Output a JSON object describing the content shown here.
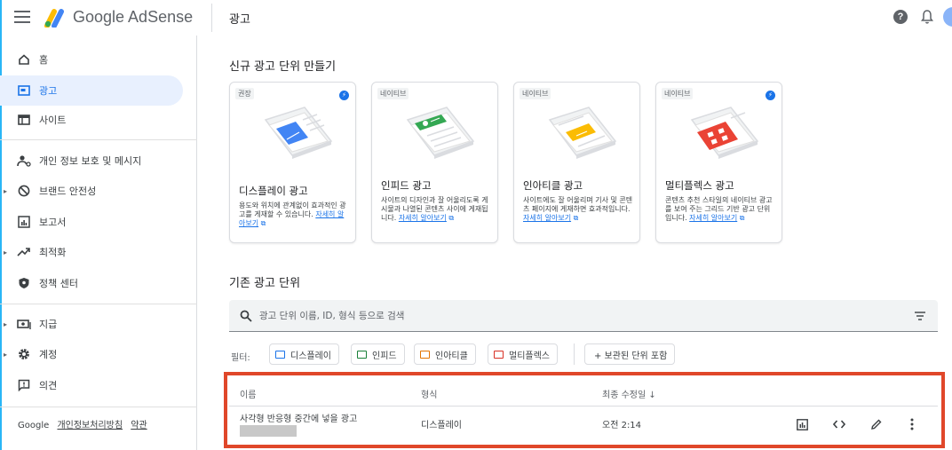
{
  "app": {
    "brand": "Google AdSense",
    "page_title": "광고",
    "help_glyph": "?"
  },
  "sidebar": {
    "items": [
      {
        "label": "홈",
        "icon": "home-icon"
      },
      {
        "label": "광고",
        "icon": "ads-icon",
        "active": true
      },
      {
        "label": "사이트",
        "icon": "sites-icon"
      },
      {
        "label": "개인 정보 보호 및 메시지",
        "icon": "privacy-person-icon"
      },
      {
        "label": "브랜드 안전성",
        "icon": "block-icon",
        "expandable": true
      },
      {
        "label": "보고서",
        "icon": "reports-icon"
      },
      {
        "label": "최적화",
        "icon": "trending-icon",
        "expandable": true
      },
      {
        "label": "정책 센터",
        "icon": "shield-icon"
      },
      {
        "label": "지급",
        "icon": "payments-icon",
        "expandable": true
      },
      {
        "label": "계정",
        "icon": "gear-icon",
        "expandable": true
      },
      {
        "label": "의견",
        "icon": "feedback-icon"
      }
    ],
    "footer": {
      "google": "Google",
      "privacy": "개인정보처리방침",
      "terms": "약관"
    }
  },
  "create_section": {
    "title": "신규 광고 단위 만들기",
    "learn_more": "자세히 알아보기",
    "cards": [
      {
        "tag": "권장",
        "title": "디스플레이 광고",
        "desc": "용도와 위치에 관계없이 효과적인 광고를 게재할 수 있습니다.",
        "accent": "#4285f4",
        "bolt": true
      },
      {
        "tag": "네이티브",
        "title": "인피드 광고",
        "desc": "사이트의 디자인과 잘 어울리도록 게시물과 나열된 콘텐츠 사이에 게재됩니다.",
        "accent": "#34a853",
        "bolt": false
      },
      {
        "tag": "네이티브",
        "title": "인아티클 광고",
        "desc": "사이트에도 잘 어울리며 기사 및 콘텐츠 페이지에 게재하면 효과적입니다.",
        "accent": "#fbbc04",
        "bolt": false
      },
      {
        "tag": "네이티브",
        "title": "멀티플렉스 광고",
        "desc": "콘텐츠 추천 스타일의 네이티브 광고를 보여 주는 그리드 기반 광고 단위입니다.",
        "accent": "#ea4335",
        "bolt": true
      }
    ]
  },
  "existing_section": {
    "title": "기존 광고 단위",
    "search_placeholder": "광고 단위 이름, ID, 형식 등으로 검색",
    "filter_label": "필터:",
    "chips": [
      {
        "label": "디스플레이",
        "color": "#1a73e8"
      },
      {
        "label": "인피드",
        "color": "#188038"
      },
      {
        "label": "인아티클",
        "color": "#e37400"
      },
      {
        "label": "멀티플렉스",
        "color": "#d93025"
      }
    ],
    "archived_chip": "+  보관된 단위 포함",
    "columns": [
      "이름",
      "형식",
      "최종 수정일 ↓"
    ],
    "rows": [
      {
        "name": "사각형 반응형 중간에 넣을 광고",
        "format": "디스플레이",
        "modified": "오전 2:14"
      }
    ]
  },
  "colors": {
    "highlight_frame": "#e0472a",
    "active_nav": "#e8f0fe",
    "link": "#1a73e8"
  }
}
